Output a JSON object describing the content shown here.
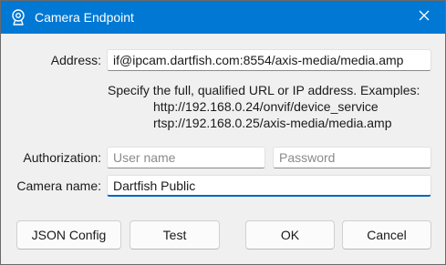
{
  "window": {
    "title": "Camera Endpoint",
    "icon": "webcam-icon",
    "close_icon": "close-icon",
    "accent_color": "#0078d4"
  },
  "address": {
    "label": "Address:",
    "value": "if@ipcam.dartfish.com:8554/axis-media/media.amp"
  },
  "hint": {
    "line1": "Specify the full, qualified URL or IP address. Examples:",
    "example1": "http://192.168.0.24/onvif/device_service",
    "example2": "rtsp://192.168.0.25/axis-media/media.amp"
  },
  "authorization": {
    "label": "Authorization:",
    "username_placeholder": "User name",
    "password_placeholder": "Password"
  },
  "camera_name": {
    "label": "Camera name:",
    "value": "Dartfish Public"
  },
  "buttons": {
    "json_config": "JSON Config",
    "test": "Test",
    "ok": "OK",
    "cancel": "Cancel"
  }
}
